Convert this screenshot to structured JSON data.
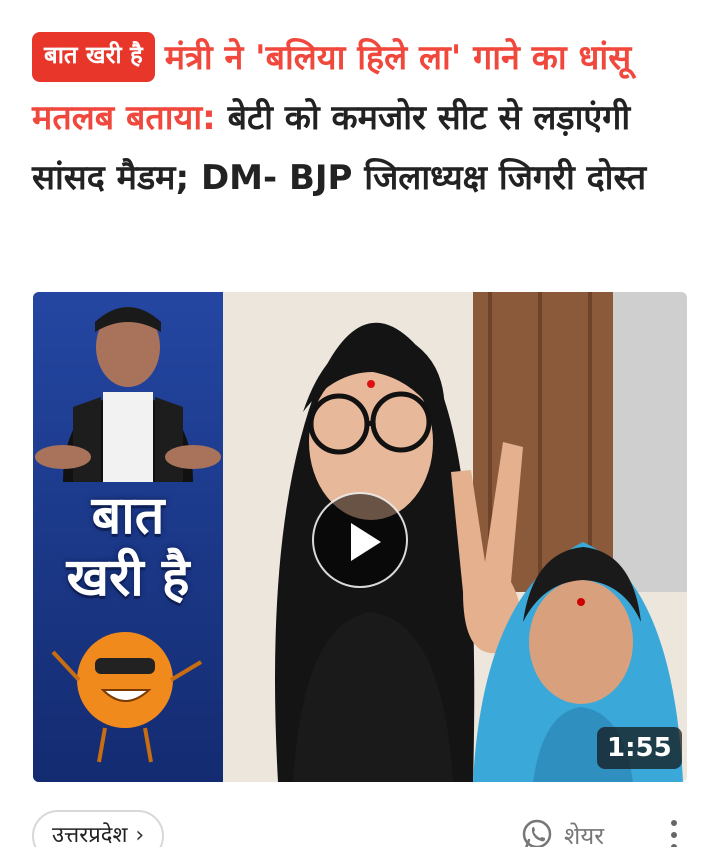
{
  "headline": {
    "badge": "बात खरी है",
    "red_part": "मंत्री ने 'बलिया हिले ला' गाने का धांसू मतलब बताया:",
    "dark_part": "बेटी को कमजोर सीट से लड़ाएंगी सांसद मैडम; DM- BJP जिलाध्यक्ष जिगरी दोस्त"
  },
  "video": {
    "panel_text_line1": "बात",
    "panel_text_line2": "खरी है",
    "duration": "1:55",
    "play_icon": "play-icon"
  },
  "footer": {
    "category": "उत्तरप्रदेश",
    "category_chevron": "›",
    "share_label": "शेयर",
    "share_icon": "whatsapp-icon",
    "more_icon": "more-vertical-icon"
  },
  "colors": {
    "accent_red": "#e8362b",
    "headline_red": "#f0483d",
    "panel_blue": "#1b3a8c"
  }
}
